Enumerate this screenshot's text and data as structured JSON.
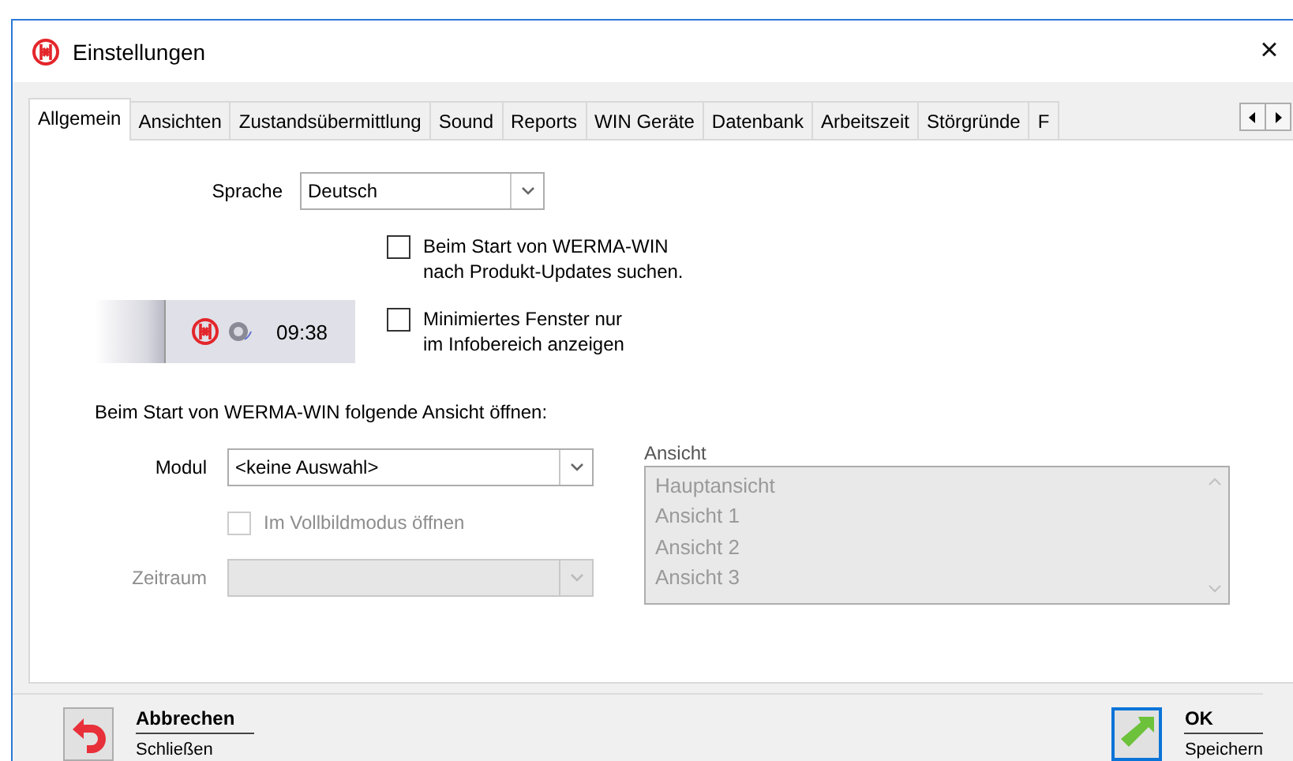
{
  "window": {
    "title": "Einstellungen",
    "close": "×"
  },
  "tabs": [
    {
      "label": "Allgemein",
      "selected": true
    },
    {
      "label": "Ansichten",
      "selected": false
    },
    {
      "label": "Zustandsübermittlung",
      "selected": false
    },
    {
      "label": "Sound",
      "selected": false
    },
    {
      "label": "Reports",
      "selected": false
    },
    {
      "label": "WIN Geräte",
      "selected": false
    },
    {
      "label": "Datenbank",
      "selected": false
    },
    {
      "label": "Arbeitszeit",
      "selected": false
    },
    {
      "label": "Störgründe",
      "selected": false
    },
    {
      "label": "F",
      "selected": false
    }
  ],
  "language": {
    "label": "Sprache",
    "value": "Deutsch"
  },
  "update_check": {
    "label": "Beim Start von WERMA-WIN\nnach Produkt-Updates suchen.",
    "checked": false
  },
  "tray_preview": {
    "time": "09:38"
  },
  "tray_only": {
    "label": "Minimiertes Fenster nur\nim Infobereich anzeigen",
    "checked": false
  },
  "startup_heading": "Beim Start von WERMA-WIN folgende Ansicht öffnen:",
  "module": {
    "label": "Modul",
    "value": "<keine Auswahl>",
    "disabled": false
  },
  "fullscreen": {
    "label": "Im Vollbildmodus öffnen",
    "checked": false,
    "disabled": true
  },
  "period": {
    "label": "Zeitraum",
    "disabled": true
  },
  "view": {
    "label": "Ansicht",
    "disabled": true,
    "items": [
      "Hauptansicht",
      "Ansicht 1",
      "Ansicht 2",
      "Ansicht 3"
    ]
  },
  "buttons": [
    {
      "kind": "cancel",
      "label": "Abbrechen",
      "sublabel": "Schließen",
      "focused": false
    },
    {
      "kind": "ok",
      "label": "OK",
      "sublabel": "Speichern",
      "focused": true
    }
  ]
}
